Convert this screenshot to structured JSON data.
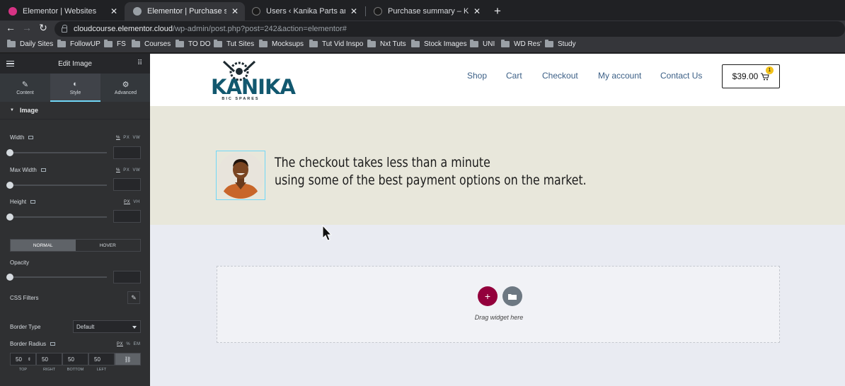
{
  "browser": {
    "tabs": [
      {
        "title": "Elementor | Websites",
        "favicon_color": "#d63384"
      },
      {
        "title": "Elementor | Purchase summary",
        "favicon_color": "#9aa0a6"
      },
      {
        "title": "Users ‹ Kanika Parts and Spares",
        "favicon_color": "#3c3c3c"
      },
      {
        "title": "Purchase summary – Kanika Parts",
        "favicon_color": "#3c3c3c"
      }
    ],
    "url_host": "cloudcourse.elementor.cloud",
    "url_path": "/wp-admin/post.php?post=242&action=elementor#",
    "bookmarks": [
      "Daily Sites",
      "FollowUP",
      "FS",
      "Courses",
      "TO DO",
      "Tut Sites",
      "Mocksups",
      "Tut Vid Inspo",
      "Nxt Tuts",
      "Stock Images",
      "UNI",
      "WD Res'",
      "Study"
    ]
  },
  "panel": {
    "title": "Edit Image",
    "tabs": [
      "Content",
      "Style",
      "Advanced"
    ],
    "section": "Image",
    "width_label": "Width",
    "width_units": [
      "%",
      "PX",
      "VW"
    ],
    "maxwidth_label": "Max Width",
    "maxwidth_units": [
      "%",
      "PX",
      "VW"
    ],
    "height_label": "Height",
    "height_units": [
      "PX",
      "VH"
    ],
    "state_normal": "NORMAL",
    "state_hover": "HOVER",
    "opacity_label": "Opacity",
    "css_filters_label": "CSS Filters",
    "border_type_label": "Border Type",
    "border_type_value": "Default",
    "border_radius_label": "Border Radius",
    "border_radius_units": [
      "PX",
      "%",
      "EM"
    ],
    "radius_values": [
      "50",
      "50",
      "50",
      "50"
    ],
    "radius_labels": [
      "TOP",
      "RIGHT",
      "BOTTOM",
      "LEFT"
    ]
  },
  "site": {
    "logo_text": "KANIKA",
    "logo_sub": "BIC SPARES",
    "nav": [
      "Shop",
      "Cart",
      "Checkout",
      "My account",
      "Contact Us"
    ],
    "cart_total": "$39.00",
    "cart_count": "1",
    "headline_1": "The checkout takes less than a minute",
    "headline_2": "using some of the best payment options on the market.",
    "drag_text": "Drag widget here"
  }
}
